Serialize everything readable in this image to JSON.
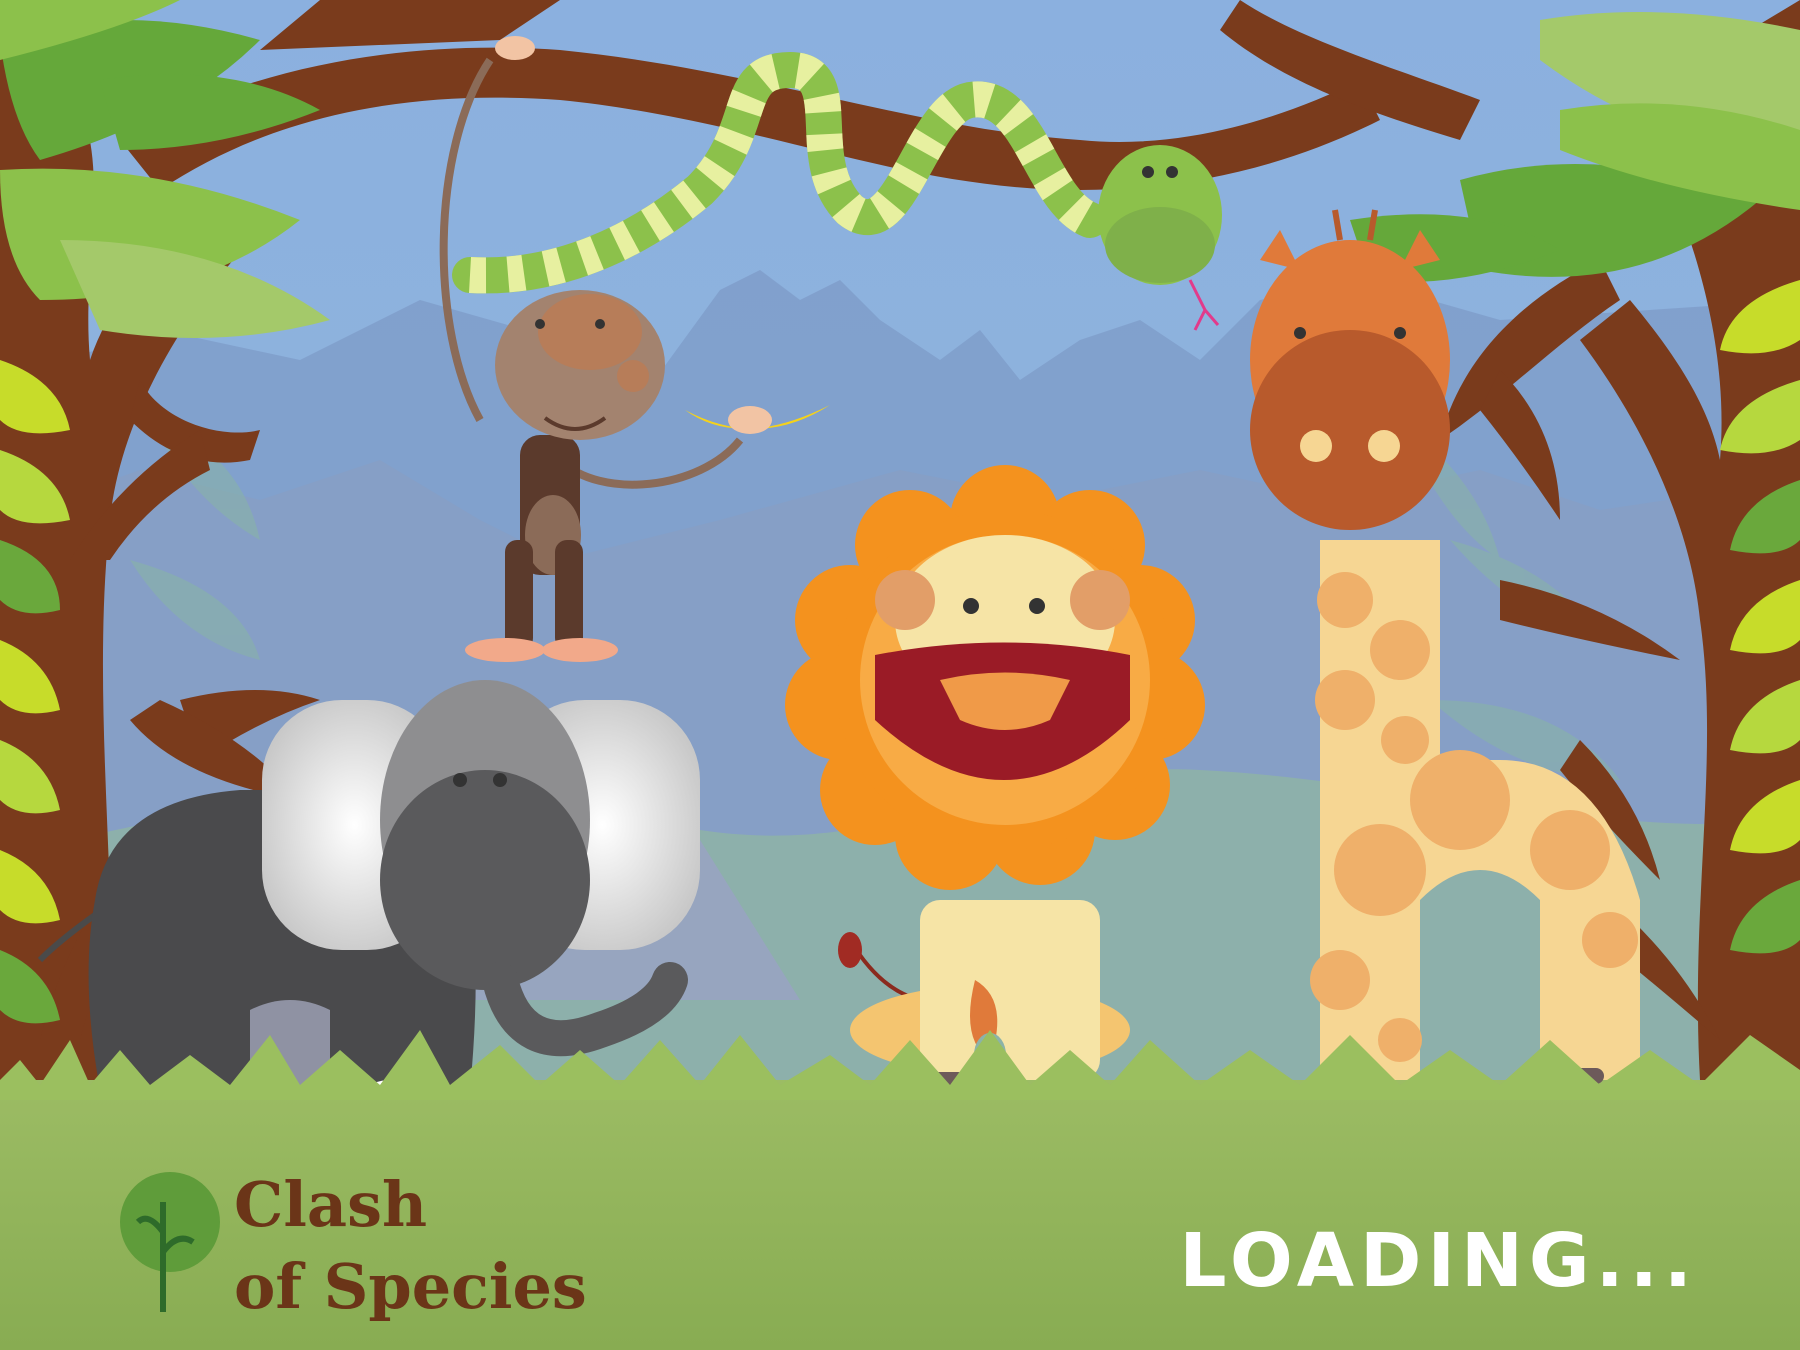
{
  "game": {
    "logo_line1": "Clash",
    "logo_line2": "of Species",
    "loading_text": "LOADING..."
  },
  "characters": [
    "monkey-icon",
    "snake-icon",
    "lion-icon",
    "giraffe-icon",
    "elephant-icon"
  ],
  "colors": {
    "sky": "#8fb2dd",
    "ground": "#8aae53",
    "trunk": "#7a3b1c",
    "logo_text": "#6b3518",
    "loading_text": "#ffffff"
  }
}
